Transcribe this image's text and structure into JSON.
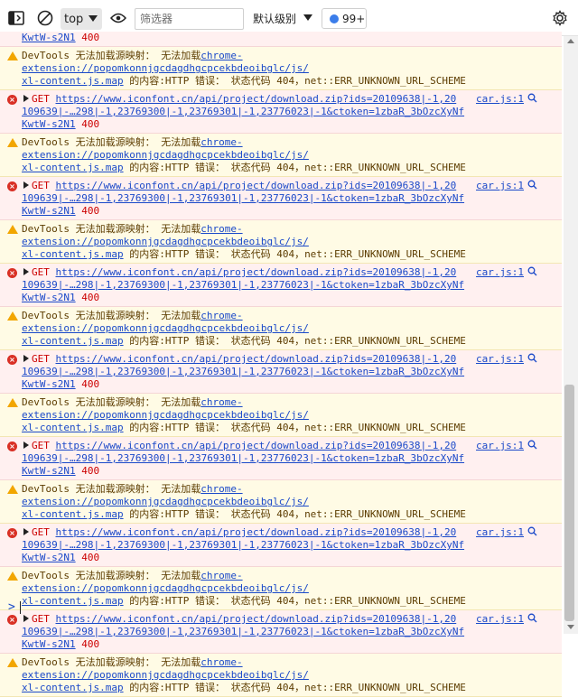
{
  "toolbar": {
    "context": "top",
    "filter_placeholder": "筛选器",
    "level_label": "默认级别",
    "issues_badge": "99+"
  },
  "top_partial": {
    "text": "KwtW-s2N1",
    "status": "400"
  },
  "warn": {
    "prefix": "DevTools 无法加载源映射： 无法加载",
    "url_part1": "chrome-extension://popomkonnjgcdagdhgcpcekbdeoibglc/js/",
    "url_part2": "xl-content.js.map",
    "suffix": " 的内容:HTTP 错误： 状态代码 404，net::ERR_UNKNOWN_URL_SCHEME"
  },
  "err": {
    "method": "GET",
    "url_line1": "https://www.iconfont.cn/api/project/download.zip?ids=20109638|-1,20",
    "url_line2": "109639|-…298|-1,23769300|-1,23769301|-1,23776023|-1&ctoken=1zbaR_3bOzcXyNf",
    "url_line3": "KwtW-s2N1",
    "status": "400",
    "source": "car.js:1"
  },
  "messages": [
    "warn",
    "err",
    "warn",
    "err",
    "warn",
    "err",
    "warn",
    "err",
    "warn",
    "err",
    "warn",
    "err",
    "warn",
    "err",
    "warn"
  ],
  "prompt_symbol": ">"
}
